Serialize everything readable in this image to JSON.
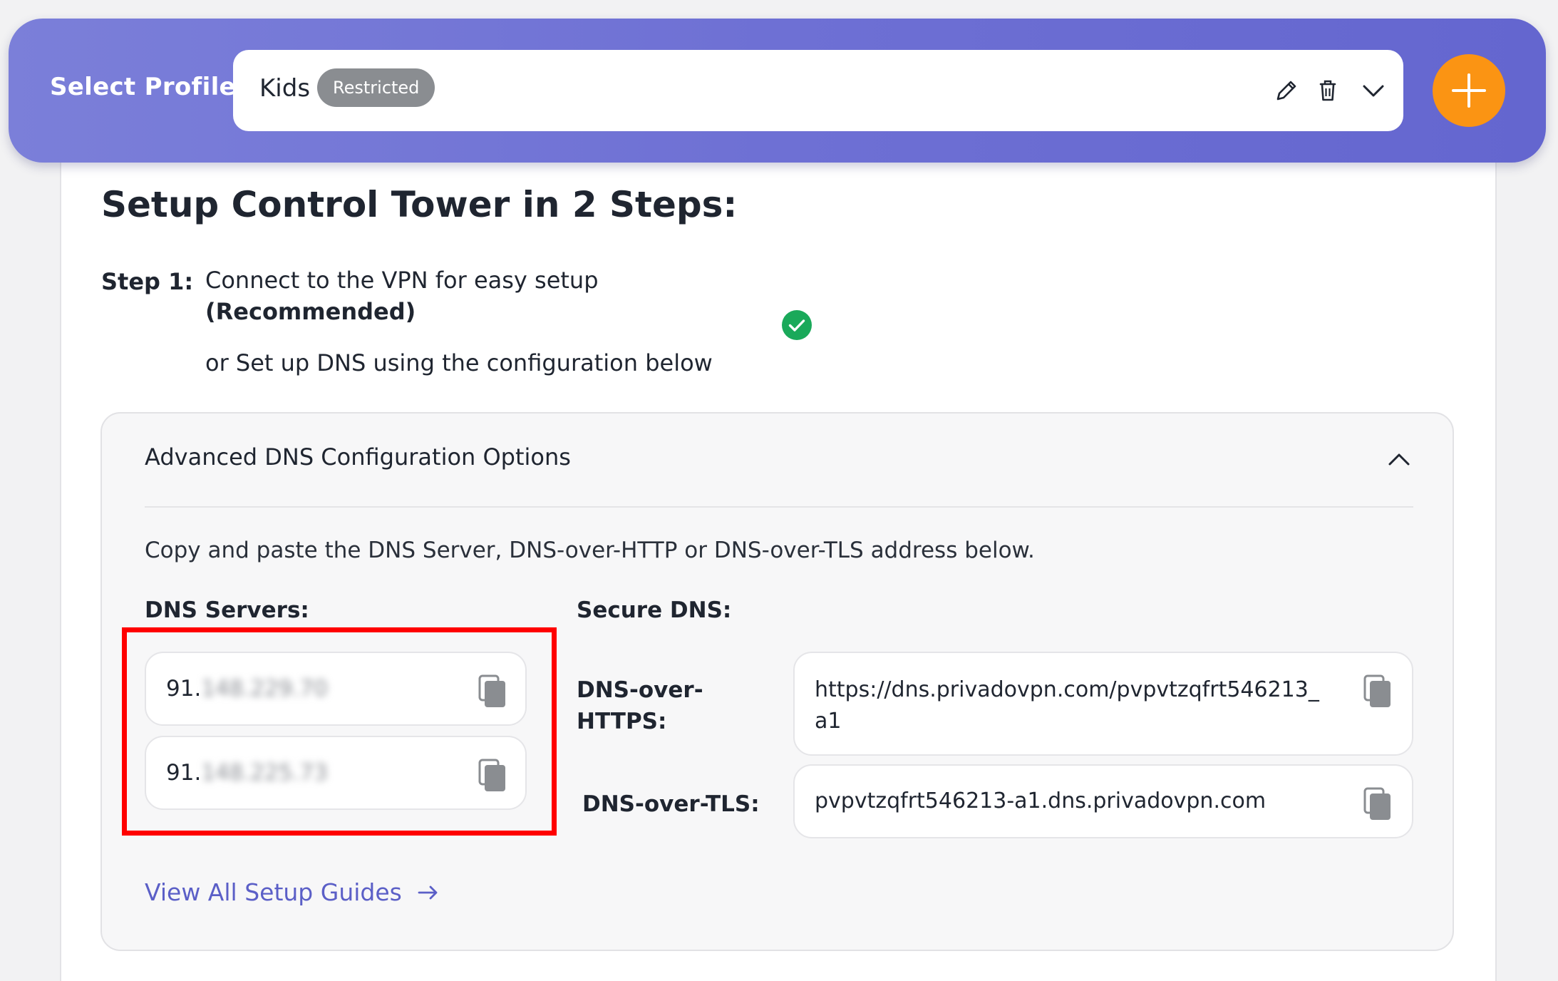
{
  "header": {
    "select_label": "Select Profile:",
    "profile_name": "Kids",
    "profile_badge": "Restricted",
    "icons": [
      "pencil-icon",
      "trash-icon",
      "chevron-down-icon",
      "plus-icon"
    ],
    "colors": {
      "header_bg": "#6e70d4",
      "add_button": "#fb9413",
      "badge_bg": "#8a8d91"
    }
  },
  "setup": {
    "title": "Setup Control Tower in 2 Steps:",
    "step1_label": "Step 1:",
    "step1_text": "Connect to the VPN for easy setup",
    "step1_recommended": "(Recommended)",
    "step1_alt": "or Set up DNS using the configuration below",
    "step1_status_icon": "check-circle-icon",
    "status_color": "#1aa95a"
  },
  "advanced": {
    "title": "Advanced DNS Configuration Options",
    "description": "Copy and paste the DNS Server, DNS-over-HTTP or DNS-over-TLS address below.",
    "dns_servers_label": "DNS Servers:",
    "dns_servers": [
      {
        "prefix": "91.",
        "masked": "148.229.70"
      },
      {
        "prefix": "91.",
        "masked": "148.225.73"
      }
    ],
    "secure_dns_label": "Secure DNS:",
    "doh_label_line1": "DNS-over-",
    "doh_label_line2": "HTTPS:",
    "doh_value_line1": "https://dns.privadovpn.com/pvpvtzqfrt546213_",
    "doh_value_line2": "a1",
    "dot_label": "DNS-over-TLS:",
    "dot_value": "pvpvtzqfrt546213-a1.dns.privadovpn.com",
    "guides_link": "View All Setup Guides",
    "link_color": "#5b5fc7",
    "highlight_color": "#ff0000"
  }
}
